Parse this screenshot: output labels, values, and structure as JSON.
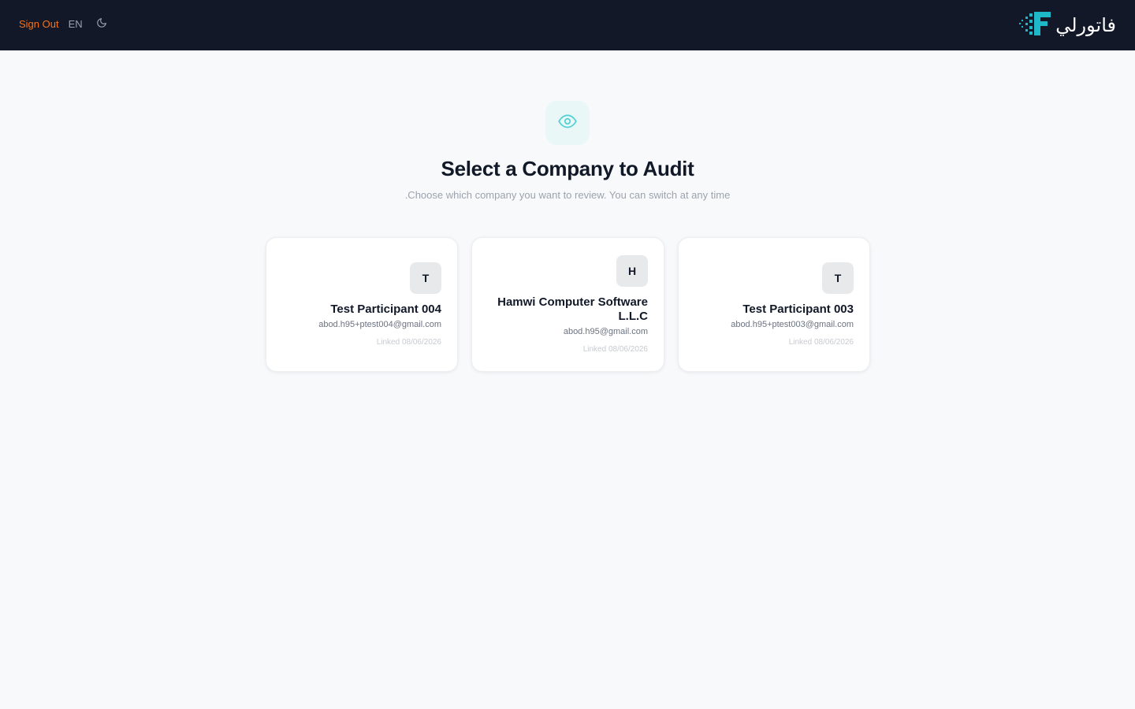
{
  "header": {
    "sign_out_label": "Sign Out",
    "language_label": "EN",
    "theme_icon": "moon-icon",
    "logo_text": "فاتورلي",
    "logo_icon": "fatorly-logo-icon",
    "brand_color": "#1fb8c9"
  },
  "hero": {
    "icon": "eye-icon",
    "title": "Select a Company to Audit",
    "subtitle": ".Choose which company you want to review. You can switch at any time"
  },
  "companies": [
    {
      "initial": "T",
      "name": "Test Participant 004",
      "email": "abod.h95+ptest004@gmail.com",
      "linked": "Linked 08/06/2026"
    },
    {
      "initial": "H",
      "name": "Hamwi Computer Software L.L.C",
      "email": "abod.h95@gmail.com",
      "linked": "Linked 08/06/2026"
    },
    {
      "initial": "T",
      "name": "Test Participant 003",
      "email": "abod.h95+ptest003@gmail.com",
      "linked": "Linked 08/06/2026"
    }
  ]
}
